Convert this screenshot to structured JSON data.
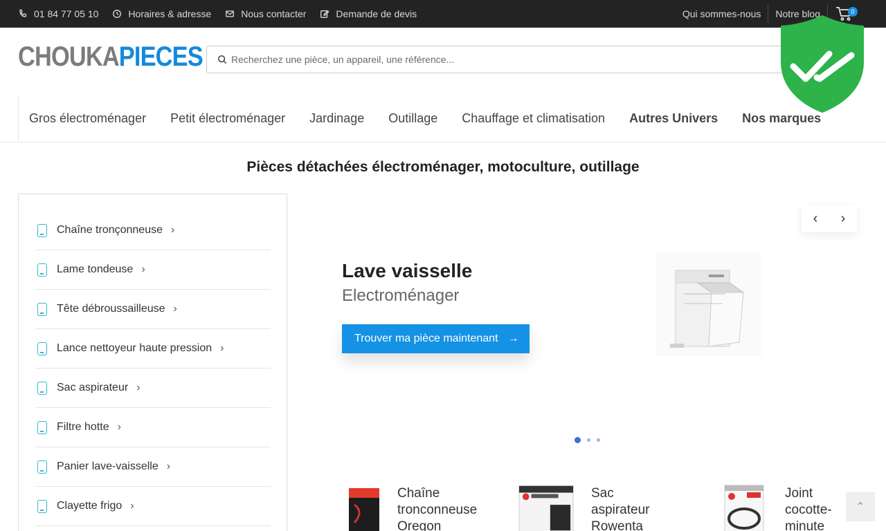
{
  "topbar": {
    "phone": "01 84 77 05 10",
    "hours": "Horaires & adresse",
    "contact": "Nous contacter",
    "quote": "Demande de devis",
    "about": "Qui sommes-nous",
    "blog": "Notre blog",
    "cart_count": "0"
  },
  "logo": {
    "part1": "CHOUKA",
    "part2": "PIECES"
  },
  "search": {
    "placeholder": "Recherchez une pièce, un appareil, une référence..."
  },
  "nav": {
    "items": [
      "Gros électroménager",
      "Petit électroménager",
      "Jardinage",
      "Outillage",
      "Chauffage et climatisation",
      "Autres Univers",
      "Nos marques"
    ]
  },
  "page_title": "Pièces détachées électroménager, motoculture, outillage",
  "sidebar": {
    "items": [
      "Chaîne tronçonneuse",
      "Lame tondeuse",
      "Tête débroussailleuse",
      "Lance nettoyeur haute pression",
      "Sac aspirateur",
      "Filtre hotte",
      "Panier lave-vaisselle",
      "Clayette frigo"
    ]
  },
  "slider": {
    "title": "Lave vaisselle",
    "subtitle": "Electroménager",
    "cta": "Trouver ma pièce maintenant",
    "prev": "‹",
    "next": "›"
  },
  "products": [
    {
      "line1": "Chaîne",
      "line2": "tronconneuse",
      "line3": "Oregon"
    },
    {
      "line1": "Sac",
      "line2": "aspirateur",
      "line3": "Rowenta"
    },
    {
      "line1": "Joint",
      "line2": "cocotte-",
      "line3": "minute Seb"
    }
  ],
  "colors": {
    "accent": "#1492e6",
    "topbar": "#232323",
    "shield": "#2db34a"
  }
}
